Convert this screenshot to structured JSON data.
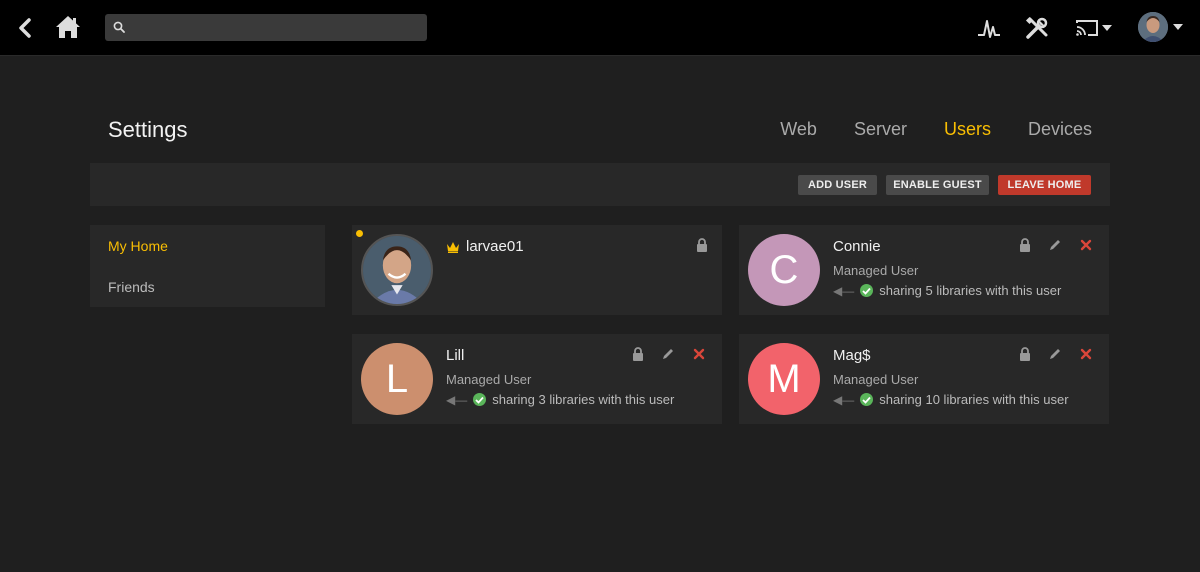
{
  "topbar": {
    "search_placeholder": "",
    "icons": [
      "back-icon",
      "home-icon",
      "search-icon",
      "activity-icon",
      "tools-icon",
      "cast-icon",
      "user-avatar"
    ]
  },
  "header": {
    "title": "Settings",
    "tabs": [
      {
        "label": "Web",
        "active": false
      },
      {
        "label": "Server",
        "active": false
      },
      {
        "label": "Users",
        "active": true
      },
      {
        "label": "Devices",
        "active": false
      }
    ]
  },
  "actions": {
    "add_user": "ADD USER",
    "enable_guest": "ENABLE GUEST",
    "leave_home": "LEAVE HOME"
  },
  "sidebar": {
    "items": [
      {
        "label": "My Home",
        "active": true
      },
      {
        "label": "Friends",
        "active": false
      }
    ]
  },
  "users": [
    {
      "name": "larvae01",
      "owner": true,
      "role": "",
      "sharing": ""
    },
    {
      "name": "Connie",
      "owner": false,
      "initial": "C",
      "avatar_color": "#c497b8",
      "role": "Managed User",
      "sharing": "sharing 5 libraries with this user"
    },
    {
      "name": "Lill",
      "owner": false,
      "initial": "L",
      "avatar_color": "#cc8f6e",
      "role": "Managed User",
      "sharing": "sharing 3 libraries with this user"
    },
    {
      "name": "Mag$",
      "owner": false,
      "initial": "M",
      "avatar_color": "#f2636b",
      "role": "Managed User",
      "sharing": "sharing 10 libraries with this user"
    }
  ],
  "colors": {
    "accent": "#f9be03",
    "danger": "#c0392b",
    "success": "#5ab55a",
    "background": "#1f1f1f",
    "panel": "#282828"
  }
}
